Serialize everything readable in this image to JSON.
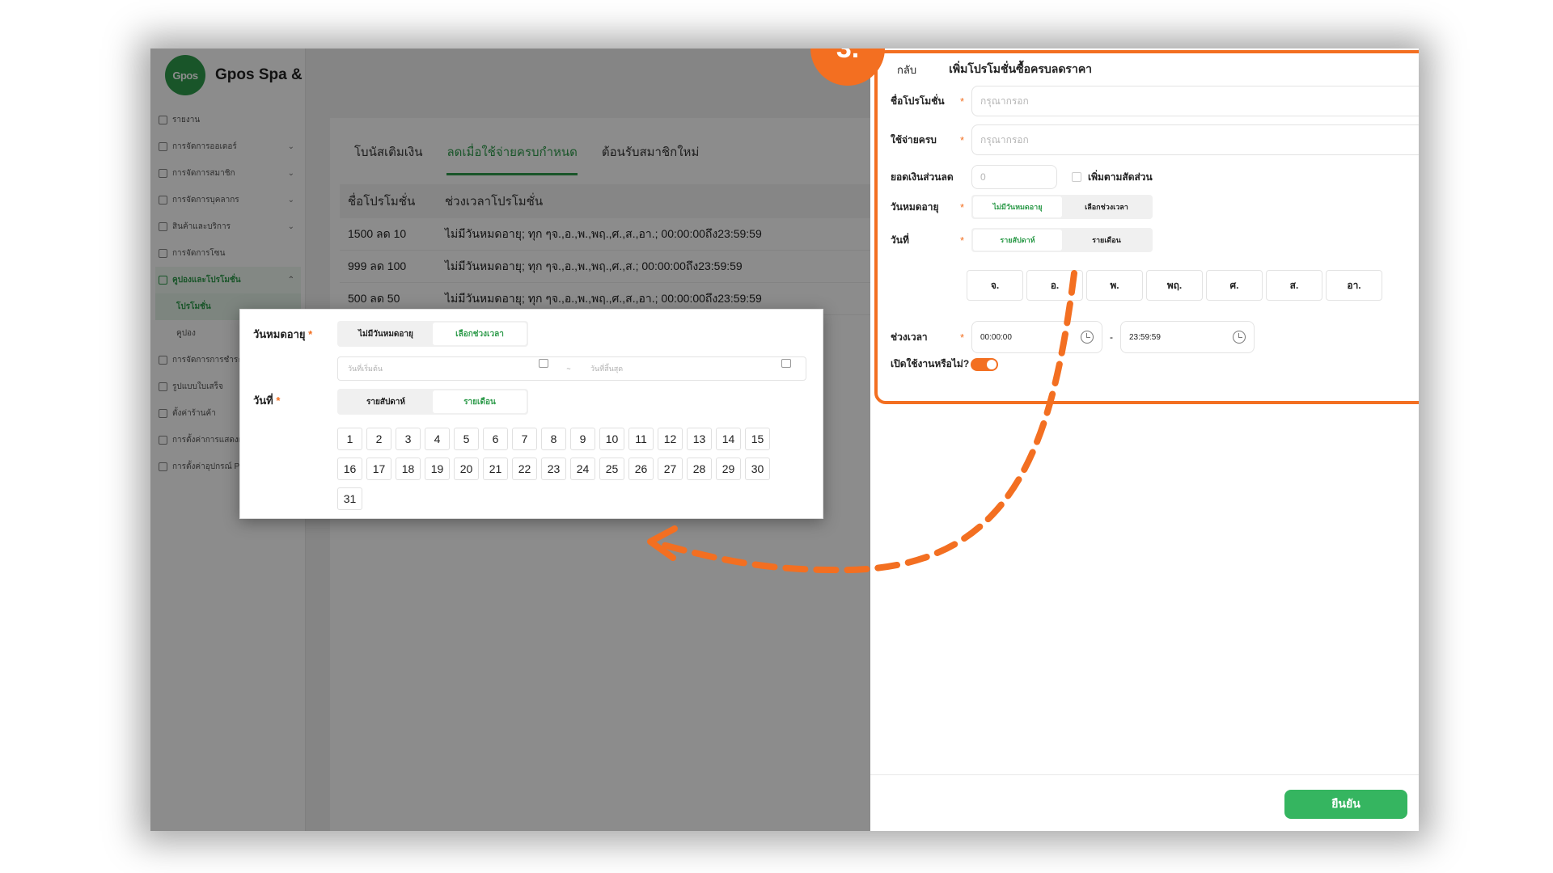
{
  "app": {
    "logo_text": "Gpos",
    "name": "Gpos Spa & Massage"
  },
  "sidebar": {
    "items": [
      {
        "label": "รายงาน",
        "expandable": false
      },
      {
        "label": "การจัดการออเดอร์",
        "expandable": true
      },
      {
        "label": "การจัดการสมาชิก",
        "expandable": true
      },
      {
        "label": "การจัดการบุคลากร",
        "expandable": true
      },
      {
        "label": "สินค้าและบริการ",
        "expandable": true
      },
      {
        "label": "การจัดการโซน",
        "expandable": false
      },
      {
        "label": "คูปองและโปรโมชั่น",
        "expandable": true,
        "active": true
      },
      {
        "label": "โปรโมชั่น",
        "sub": true,
        "active": true
      },
      {
        "label": "คูปอง",
        "sub": true
      },
      {
        "label": "การจัดการการชำระเงิน",
        "expandable": false
      },
      {
        "label": "รูปแบบใบเสร็จ",
        "expandable": false
      },
      {
        "label": "ตั้งค่าร้านค้า",
        "expandable": false
      },
      {
        "label": "การตั้งค่าการแสดงผล",
        "expandable": false
      },
      {
        "label": "การตั้งค่าอุปกรณ์ POS",
        "expandable": false
      }
    ]
  },
  "main": {
    "tabs": [
      "โบนัสเติมเงิน",
      "ลดเมื่อใช้จ่ายครบกำหนด",
      "ต้อนรับสมาชิกใหม่"
    ],
    "active_tab": 1,
    "table": {
      "headers": [
        "ชื่อโปรโมชั่น",
        "ช่วงเวลาโปรโมชั่น"
      ],
      "rows": [
        [
          "1500 ลด 10",
          "ไม่มีวันหมดอายุ; ทุก ๆจ.,อ.,พ.,พฤ.,ศ.,ส.,อา.; 00:00:00ถึง23:59:59"
        ],
        [
          "999 ลด 100",
          "ไม่มีวันหมดอายุ; ทุก ๆจ.,อ.,พ.,พฤ.,ศ.,ส.; 00:00:00ถึง23:59:59"
        ],
        [
          "500 ลด 50",
          "ไม่มีวันหมดอายุ; ทุก ๆจ.,อ.,พ.,พฤ.,ศ.,ส.,อา.; 00:00:00ถึง23:59:59"
        ]
      ]
    }
  },
  "step_badge": "3.",
  "drawer": {
    "back_label": "กลับ",
    "title": "เพิ่มโปรโมชั่นซื้อครบลดราคา",
    "fields": {
      "name_label": "ชื่อโปรโมชั่น",
      "name_placeholder": "กรุณากรอก",
      "spend_label": "ใช้จ่ายครบ",
      "spend_placeholder": "กรุณากรอก",
      "discount_label": "ยอดเงินส่วนลด",
      "discount_value": "0",
      "percent_label": "เพิ่มตามสัดส่วน",
      "expiry_label": "วันหมดอายุ",
      "expiry_options": [
        "ไม่มีวันหมดอายุ",
        "เลือกช่วงเวลา"
      ],
      "date_label": "วันที่",
      "date_options": [
        "รายสัปดาห์",
        "รายเดือน"
      ],
      "weekdays": [
        "จ.",
        "อ.",
        "พ.",
        "พฤ.",
        "ศ.",
        "ส.",
        "อา."
      ],
      "time_label": "ช่วงเวลา",
      "time_start": "00:00:00",
      "time_sep": "-",
      "time_end": "23:59:59",
      "enable_label": "เปิดใช้งานหรือไม่?",
      "enabled": true
    },
    "confirm_label": "ยืนยัน"
  },
  "popup": {
    "expiry_label": "วันหมดอายุ",
    "expiry_options": [
      "ไม่มีวันหมดอายุ",
      "เลือกช่วงเวลา"
    ],
    "start_placeholder": "วันที่เริ่มต้น",
    "range_sep": "~",
    "end_placeholder": "วันที่สิ้นสุด",
    "date_label": "วันที่",
    "date_options": [
      "รายสัปดาห์",
      "รายเดือน"
    ],
    "days": [
      "1",
      "2",
      "3",
      "4",
      "5",
      "6",
      "7",
      "8",
      "9",
      "10",
      "11",
      "12",
      "13",
      "14",
      "15",
      "16",
      "17",
      "18",
      "19",
      "20",
      "21",
      "22",
      "23",
      "24",
      "25",
      "26",
      "27",
      "28",
      "29",
      "30",
      "31"
    ]
  },
  "colors": {
    "brand_green": "#2e9b4b",
    "confirm_green": "#35b560",
    "highlight_orange": "#f36f21"
  }
}
